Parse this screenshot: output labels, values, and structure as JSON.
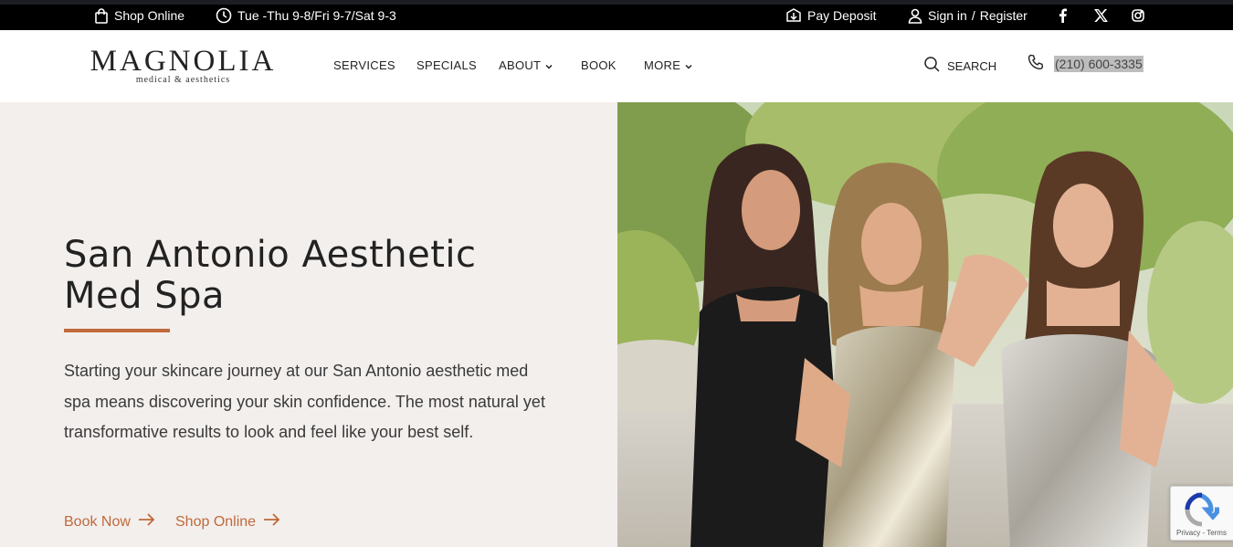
{
  "topbar": {
    "shop_online": "Shop Online",
    "hours": "Tue -Thu 9-8/Fri 9-7/Sat 9-3",
    "pay_deposit": "Pay Deposit",
    "sign_in": "Sign in",
    "separator": "/",
    "register": "Register",
    "social": [
      "facebook-icon",
      "x-twitter-icon",
      "instagram-icon"
    ]
  },
  "header": {
    "logo_main": "MAGNOLIA",
    "logo_sub": "medical & aesthetics",
    "nav": [
      "SERVICES",
      "SPECIALS",
      "ABOUT",
      "BOOK",
      "MORE"
    ],
    "search_label": "SEARCH",
    "phone": "(210) 600-3335"
  },
  "hero": {
    "title_line1": "San Antonio Aesthetic",
    "title_line2": "Med Spa",
    "text": "Starting your skincare journey at our San Antonio aesthetic med spa means discovering your skin confidence. The most natural yet transformative results to look and feel like your best self.",
    "cta_book": "Book Now",
    "cta_shop": "Shop Online"
  },
  "recaptcha": {
    "terms": "Privacy - Terms"
  },
  "colors": {
    "accent": "#c0693a",
    "topbar": "#000000",
    "hero_bg": "#f3efed"
  }
}
